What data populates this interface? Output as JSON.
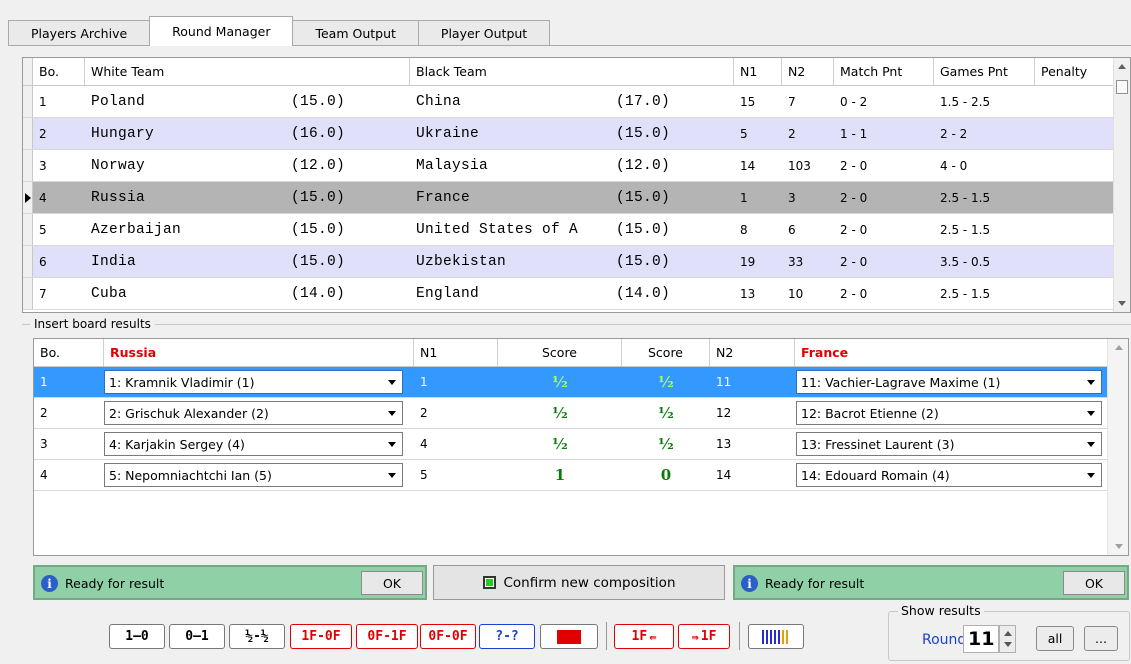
{
  "tabs": [
    {
      "label": "Players Archive",
      "active": false
    },
    {
      "label": "Round Manager",
      "active": true
    },
    {
      "label": "Team Output",
      "active": false
    },
    {
      "label": "Player Output",
      "active": false
    }
  ],
  "pairings": {
    "headers": {
      "bo": "Bo.",
      "white": "White Team",
      "black": "Black Team",
      "n1": "N1",
      "n2": "N2",
      "match": "Match Pnt",
      "games": "Games Pnt",
      "penalty": "Penalty"
    },
    "rows": [
      {
        "bo": "1",
        "white": "Poland",
        "wpts": "(15.0)",
        "black": "China",
        "bpts": "(17.0)",
        "n1": "15",
        "n2": "7",
        "match": "0 - 2",
        "games": "1.5 - 2.5",
        "style": "white"
      },
      {
        "bo": "2",
        "white": "Hungary",
        "wpts": "(16.0)",
        "black": "Ukraine",
        "bpts": "(15.0)",
        "n1": "5",
        "n2": "2",
        "match": "1 - 1",
        "games": "2 - 2",
        "style": "lav"
      },
      {
        "bo": "3",
        "white": "Norway",
        "wpts": "(12.0)",
        "black": "Malaysia",
        "bpts": "(12.0)",
        "n1": "14",
        "n2": "103",
        "match": "2 - 0",
        "games": "4 - 0",
        "style": "white"
      },
      {
        "bo": "4",
        "white": "Russia",
        "wpts": "(15.0)",
        "black": "France",
        "bpts": "(15.0)",
        "n1": "1",
        "n2": "3",
        "match": "2 - 0",
        "games": "2.5 - 1.5",
        "style": "sel"
      },
      {
        "bo": "5",
        "white": "Azerbaijan",
        "wpts": "(15.0)",
        "black": "United States of A",
        "bpts": "(15.0)",
        "n1": "8",
        "n2": "6",
        "match": "2 - 0",
        "games": "2.5 - 1.5",
        "style": "white"
      },
      {
        "bo": "6",
        "white": "India",
        "wpts": "(15.0)",
        "black": "Uzbekistan",
        "bpts": "(15.0)",
        "n1": "19",
        "n2": "33",
        "match": "2 - 0",
        "games": "3.5 - 0.5",
        "style": "lav"
      },
      {
        "bo": "7",
        "white": "Cuba",
        "wpts": "(14.0)",
        "black": "England",
        "bpts": "(14.0)",
        "n1": "13",
        "n2": "10",
        "match": "2 - 0",
        "games": "2.5 - 1.5",
        "style": "white"
      }
    ]
  },
  "boards": {
    "group_label": "Insert board results",
    "headers": {
      "bo": "Bo.",
      "white_team": "Russia",
      "n1": "N1",
      "score1": "Score",
      "score2": "Score",
      "n2": "N2",
      "black_team": "France"
    },
    "rows": [
      {
        "bo": "1",
        "white": "1: Kramnik Vladimir (1)",
        "n1": "1",
        "s1": "½",
        "s2": "½",
        "n2": "11",
        "black": "11: Vachier-Lagrave Maxime (1)",
        "selected": true
      },
      {
        "bo": "2",
        "white": "2: Grischuk Alexander (2)",
        "n1": "2",
        "s1": "½",
        "s2": "½",
        "n2": "12",
        "black": "12: Bacrot Etienne (2)",
        "selected": false
      },
      {
        "bo": "3",
        "white": "4: Karjakin Sergey (4)",
        "n1": "4",
        "s1": "½",
        "s2": "½",
        "n2": "13",
        "black": "13: Fressinet Laurent (3)",
        "selected": false
      },
      {
        "bo": "4",
        "white": "5: Nepomniachtchi Ian (5)",
        "n1": "5",
        "s1": "1",
        "s2": "0",
        "n2": "14",
        "black": "14: Edouard Romain (4)",
        "selected": false
      }
    ]
  },
  "status": {
    "left": {
      "text": "Ready for result",
      "ok": "OK"
    },
    "confirm": "Confirm new composition",
    "right": {
      "text": "Ready for result",
      "ok": "OK"
    }
  },
  "toolbar": {
    "win_white": "1–0",
    "win_black": "0–1",
    "draw": "½-½",
    "ff_white": "1F-0F",
    "ff_black": "0F-1F",
    "ff_both": "0F-0F",
    "unknown": "?-?",
    "ff_left": "1F",
    "ff_right": "1F"
  },
  "show_results": {
    "label": "Show results",
    "round_label": "Round",
    "round_value": "11",
    "all_button": "all",
    "more_button": "..."
  },
  "colors": {
    "accent_red": "#e00000",
    "accent_blue": "#1a40d0",
    "status_green": "#8fd0a6",
    "selection_blue": "#3399ff"
  }
}
